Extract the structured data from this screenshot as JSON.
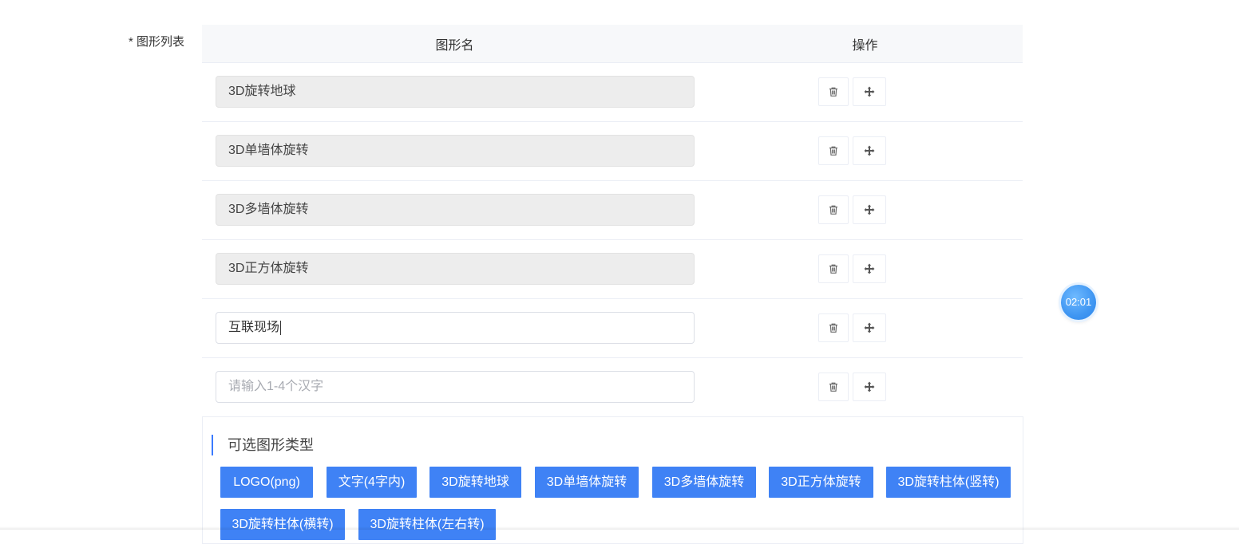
{
  "form": {
    "label": "* 图形列表"
  },
  "table": {
    "headers": {
      "name": "图形名",
      "operation": "操作"
    },
    "rows": [
      {
        "value": "3D旋转地球",
        "disabled": true
      },
      {
        "value": "3D单墙体旋转",
        "disabled": true
      },
      {
        "value": "3D多墙体旋转",
        "disabled": true
      },
      {
        "value": "3D正方体旋转",
        "disabled": true
      },
      {
        "value": "互联现场",
        "disabled": false,
        "focused": true
      },
      {
        "value": "",
        "placeholder": "请输入1-4个汉字",
        "disabled": false
      }
    ],
    "icons": {
      "delete": "trash-icon",
      "move": "move-arrows-icon"
    }
  },
  "panel": {
    "title": "可选图形类型",
    "types": [
      "LOGO(png)",
      "文字(4字内)",
      "3D旋转地球",
      "3D单墙体旋转",
      "3D多墙体旋转",
      "3D正方体旋转",
      "3D旋转柱体(竖转)",
      "3D旋转柱体(横转)",
      "3D旋转柱体(左右转)"
    ]
  },
  "timer": {
    "text": "02:01"
  },
  "colors": {
    "primary": "#3f82f5",
    "accent_bar": "#3a7afe",
    "disabled_bg": "#ededed"
  }
}
